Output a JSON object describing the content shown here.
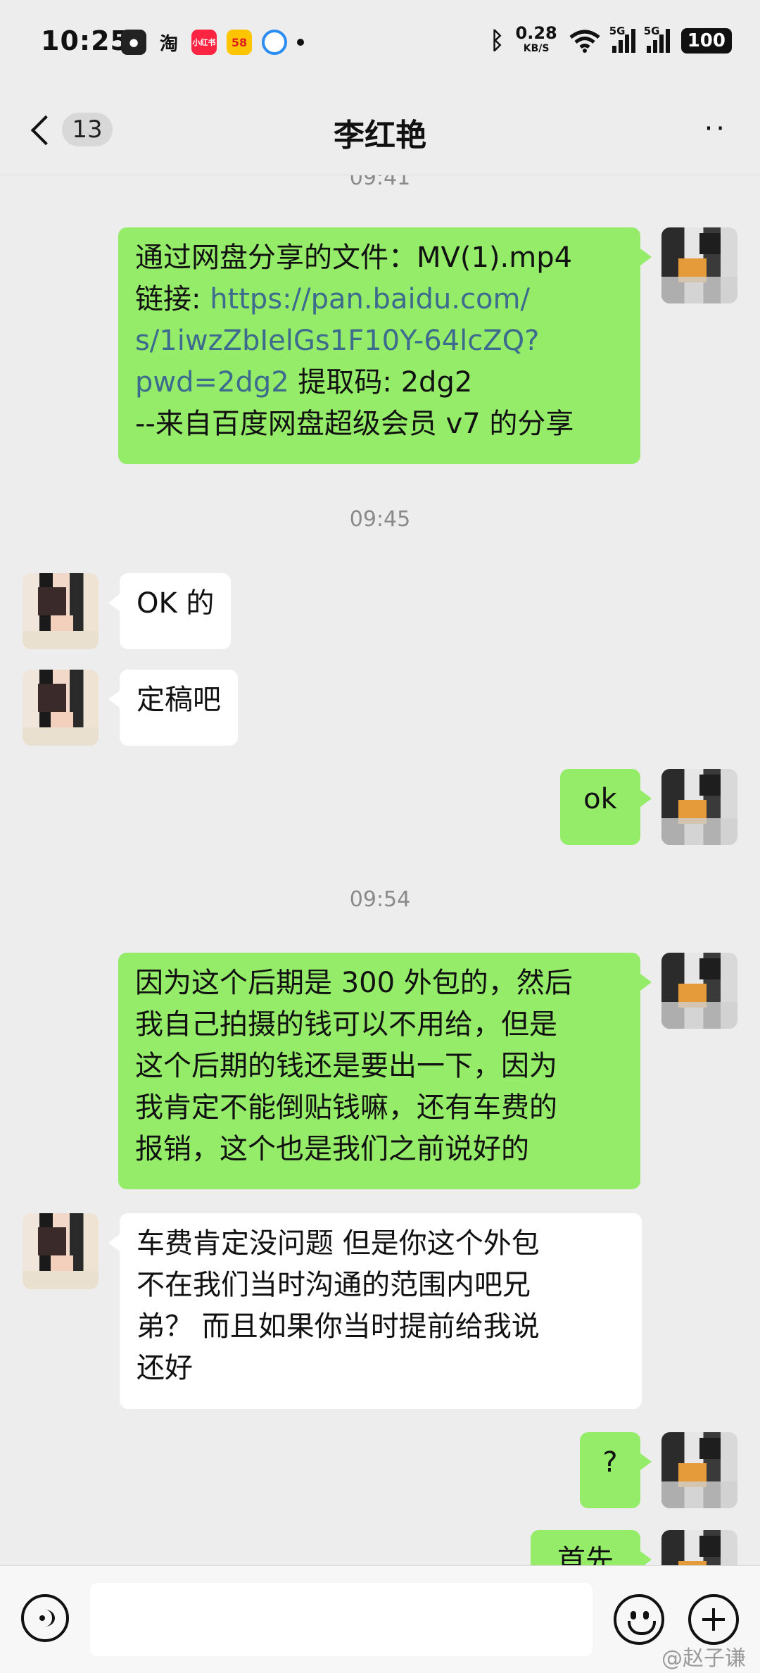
{
  "status_bar": {
    "time": "10:25",
    "apps": [
      "淘",
      "小红书",
      "58"
    ],
    "net_speed": "0.28",
    "net_unit": "KB/S",
    "network_label": "5G",
    "network_label_2": "5G",
    "battery": "100"
  },
  "header": {
    "unread_count": "13",
    "title": "李红艳",
    "more": "··"
  },
  "messages": {
    "ts_top": "09:41",
    "m1": {
      "line1": "通过网盘分享的文件：MV(1).mp4",
      "line2_prefix": "链接: ",
      "line2_link": "https://pan.baidu.com/",
      "line3_link": "s/1iwzZbIelGs1F10Y-64lcZQ?",
      "line4_link": "pwd=2dg2",
      "line4_suffix": " 提取码: 2dg2",
      "line5": "--来自百度网盘超级会员 v7 的分享"
    },
    "ts_2": "09:45",
    "m2": "OK 的",
    "m3": "定稿吧",
    "m4": "ok",
    "ts_3": "09:54",
    "m5": {
      "line1": "因为这个后期是 300 外包的，然后",
      "line2": "我自己拍摄的钱可以不用给，但是",
      "line3": "这个后期的钱还是要出一下，因为",
      "line4": "我肯定不能倒贴钱嘛，还有车费的",
      "line5": "报销，这个也是我们之前说好的"
    },
    "m6": {
      "line1": "车费肯定没问题 但是你这个外包",
      "line2": "不在我们当时沟通的范围内吧兄",
      "line3": "弟？ 而且如果你当时提前给我说",
      "line4": "还好"
    },
    "m7": "?",
    "m8_partial": "首先"
  },
  "input_bar": {
    "placeholder": ""
  },
  "watermark": "@赵子谦"
}
